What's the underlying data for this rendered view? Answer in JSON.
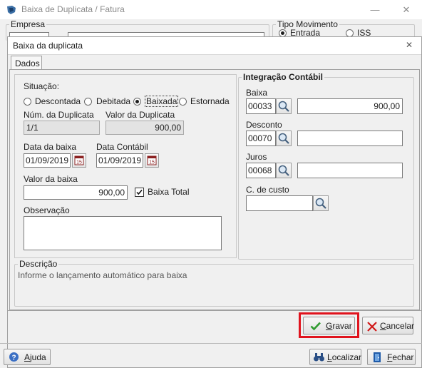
{
  "window": {
    "title": "Baixa de Duplicata / Fatura",
    "minimize_glyph": "—",
    "maximize_glyph": "☐",
    "close_glyph": "✕"
  },
  "background": {
    "empresa_label": "Empresa",
    "tipo_movimento_label": "Tipo Movimento",
    "entrada_label": "Entrada",
    "iss_label": "ISS"
  },
  "dialog": {
    "title": "Baixa da duplicata",
    "close_glyph": "✕",
    "tab_dados": "Dados",
    "situacao_label": "Situação:",
    "situacao_options": [
      "Descontada",
      "Debitada",
      "Baixada",
      "Estornada"
    ],
    "situacao_selected": "Baixada",
    "num_duplicata_label": "Núm. da Duplicata",
    "num_duplicata_value": "1/1",
    "valor_duplicata_label": "Valor da Duplicata",
    "valor_duplicata_value": "900,00",
    "data_baixa_label": "Data da baixa",
    "data_baixa_value": "01/09/2019",
    "data_contabil_label": "Data Contábil",
    "data_contabil_value": "01/09/2019",
    "calendar_glyph": "15",
    "valor_baixa_label": "Valor da baixa",
    "valor_baixa_value": "900,00",
    "baixa_total_label": "Baixa Total",
    "baixa_total_checked": true,
    "observacao_label": "Observação",
    "observacao_value": "",
    "integracao": {
      "title": "Integração Contábil",
      "baixa_label": "Baixa",
      "baixa_code": "00033",
      "baixa_value": "900,00",
      "desconto_label": "Desconto",
      "desconto_code": "00070",
      "desconto_value": "",
      "juros_label": "Juros",
      "juros_code": "00068",
      "juros_value": "",
      "centro_custo_label": "C. de custo",
      "centro_custo_value": ""
    },
    "descricao_label": "Descrição",
    "descricao_text": "Informe o lançamento automático para baixa",
    "gravar_label_prefix": "",
    "gravar_label_underlined": "G",
    "gravar_label_rest": "ravar",
    "cancelar_label_underlined": "C",
    "cancelar_label_rest": "ancelar"
  },
  "footer": {
    "ajuda_underlined": "A",
    "ajuda_rest": "juda",
    "localizar_underlined": "L",
    "localizar_rest": "ocalizar",
    "fechar_underlined": "F",
    "fechar_rest": "echar"
  },
  "colors": {
    "highlight_red": "#e0141e",
    "check_green": "#2e9a2e",
    "cancel_red": "#d01818"
  }
}
